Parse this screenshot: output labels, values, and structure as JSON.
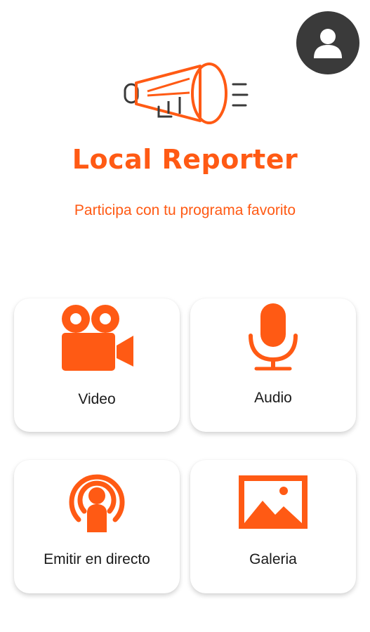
{
  "header": {
    "profile_icon": "user-profile-icon",
    "logo_icon": "megaphone-icon",
    "title": "Local Reporter",
    "subtitle": "Participa con tu programa favorito"
  },
  "menu": [
    {
      "label": "Video",
      "icon": "video-camera-icon"
    },
    {
      "label": "Audio",
      "icon": "microphone-icon"
    },
    {
      "label": "Emitir en directo",
      "icon": "live-broadcast-icon"
    },
    {
      "label": "Galeria",
      "icon": "gallery-image-icon"
    }
  ],
  "colors": {
    "accent": "#ff5a14",
    "profile_bg": "#3a3a3a",
    "text": "#1a1a1a",
    "background": "#ffffff"
  }
}
